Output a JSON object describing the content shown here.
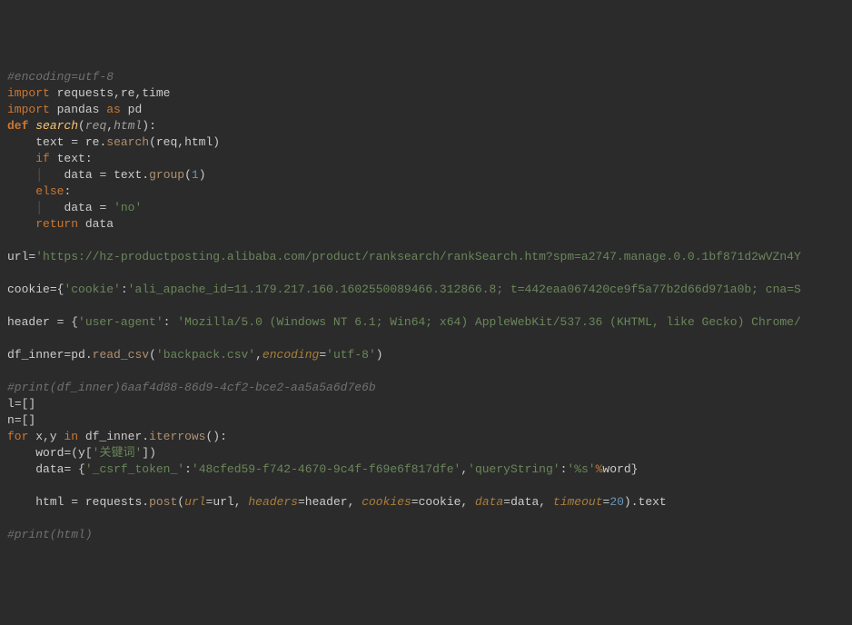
{
  "code": {
    "l1_comment": "#encoding=utf-8",
    "l2_import": "import",
    "l2_mods": " requests,re,time",
    "l3_import": "import",
    "l3_mod": " pandas ",
    "l3_as": "as",
    "l3_alias": " pd",
    "l4_def": "def ",
    "l4_fn": "search",
    "l4_p1": "req",
    "l4_p2": "html",
    "l5_var": "text ",
    "l5_eq": "= ",
    "l5_re": "re",
    "l5_search": "search",
    "l5_args": "(req,html)",
    "l6_if": "if",
    "l6_cond": " text:",
    "l7_var": "data ",
    "l7_eq": "= ",
    "l7_text": "text",
    "l7_group": "group",
    "l7_num": "1",
    "l8_else": "else",
    "l9_var": "data ",
    "l9_eq": "= ",
    "l9_str": "'no'",
    "l10_return": "return",
    "l10_val": " data",
    "l12_var": "url",
    "l12_eq": "=",
    "l12_str": "'https://hz-productposting.alibaba.com/product/ranksearch/rankSearch.htm?spm=a2747.manage.0.0.1bf871d2wVZn4Y",
    "l14_var": "cookie",
    "l14_eq": "=",
    "l14_k": "'cookie'",
    "l14_v": "'ali_apache_id=11.179.217.160.1602550089466.312866.8; t=442eaa067420ce9f5a77b2d66d971a0b; cna=S",
    "l16_var": "header ",
    "l16_eq": "= ",
    "l16_k": "'user-agent'",
    "l16_sep": ": ",
    "l16_v": "'Mozilla/5.0 (Windows NT 6.1; Win64; x64) AppleWebKit/537.36 (KHTML, like Gecko) Chrome/",
    "l18_var": "df_inner",
    "l18_eq": "=",
    "l18_pd": "pd",
    "l18_read": "read_csv",
    "l18_file": "'backpack.csv'",
    "l18_kwarg": "encoding",
    "l18_enc": "'utf-8'",
    "l20_comment": "#print(df_inner)6aaf4d88-86d9-4cf2-bce2-aa5a5a6d7e6b",
    "l21_var": "l",
    "l21_eq": "=",
    "l22_var": "n",
    "l22_eq": "=",
    "l23_for": "for",
    "l23_xy": " x,y ",
    "l23_in": "in",
    "l23_df": " df_inner",
    "l23_iter": "iterrows",
    "l24_var": "word",
    "l24_eq": "=",
    "l24_y": "(y[",
    "l24_key": "'关键词'",
    "l24_close": "])",
    "l25_var": "data",
    "l25_eq": "= ",
    "l25_k1": "'_csrf_token_'",
    "l25_v1": "'48cfed59-f742-4670-9c4f-f69e6f817dfe'",
    "l25_k2": "'queryString'",
    "l25_v2a": "'%s'",
    "l25_pct": "%",
    "l25_word": "word}",
    "l27_var": "html ",
    "l27_eq": "= ",
    "l27_req": "requests",
    "l27_post": "post",
    "l27_url_k": "url",
    "l27_url_v": "url",
    "l27_hdr_k": "headers",
    "l27_hdr_v": "header",
    "l27_ck_k": "cookies",
    "l27_ck_v": "cookie",
    "l27_dt_k": "data",
    "l27_dt_v": "data",
    "l27_to_k": "timeout",
    "l27_to_v": "20",
    "l27_text": "text",
    "l29_comment": "#print(html)"
  }
}
